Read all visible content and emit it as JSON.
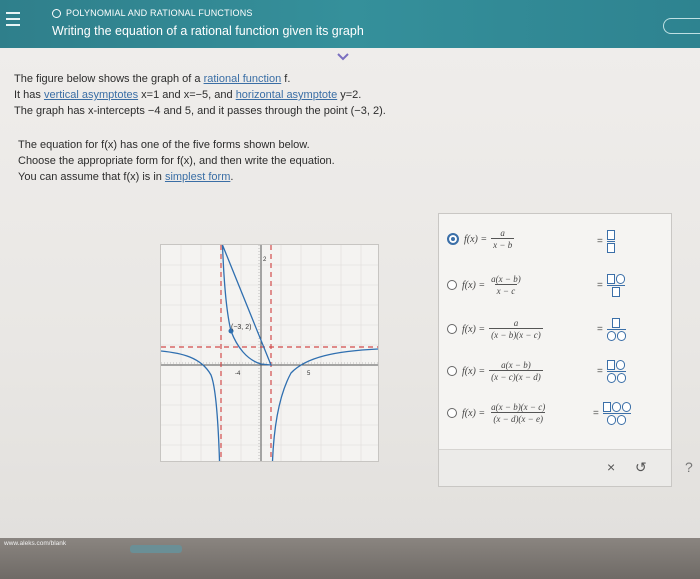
{
  "header": {
    "topic": "POLYNOMIAL AND RATIONAL FUNCTIONS",
    "title": "Writing the equation of a rational function given its graph"
  },
  "problem": {
    "l1_a": "The figure below shows the graph of a ",
    "l1_link": "rational function",
    "l1_b": " f.",
    "l2_a": "It has ",
    "l2_link1": "vertical asymptotes",
    "l2_b": " x=1 and x=−5, and ",
    "l2_link2": "horizontal asymptote",
    "l2_c": " y=2.",
    "l3": "The graph has x-intercepts −4 and 5, and it passes through the point (−3, 2).",
    "l4": "The equation for f(x) has one of the five forms shown below.",
    "l5": "Choose the appropriate form for f(x), and then write the equation.",
    "l6_a": "You can assume that f(x) is in ",
    "l6_link": "simplest form",
    "l6_b": "."
  },
  "graph": {
    "point_label": "(−3, 2)",
    "tick_neg4": "-4",
    "tick_5": "5",
    "y_tick": "2"
  },
  "options": [
    {
      "lhs": "f(x) =",
      "num": "a",
      "den": "x − b",
      "selected": true
    },
    {
      "lhs": "f(x) =",
      "num": "a(x − b)",
      "den": "x − c",
      "selected": false
    },
    {
      "lhs": "f(x) =",
      "num": "a",
      "den": "(x − b)(x − c)",
      "selected": false
    },
    {
      "lhs": "f(x) =",
      "num": "a(x − b)",
      "den": "(x − c)(x − d)",
      "selected": false
    },
    {
      "lhs": "f(x) =",
      "num": "a(x − b)(x − c)",
      "den": "(x − d)(x − e)",
      "selected": false
    }
  ],
  "template_eq": "=",
  "footer": {
    "close": "×",
    "undo": "↺",
    "help": "?"
  },
  "browser": {
    "url": "www.aleks.com/blank"
  },
  "colors": {
    "header": "#2f7f8b",
    "accent": "#3b6fa8",
    "asymptote": "#d24b4b"
  }
}
